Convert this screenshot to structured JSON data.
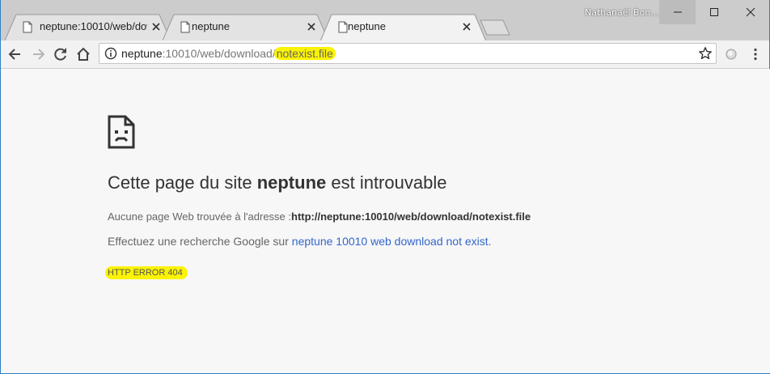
{
  "window": {
    "user_name": "Nathanaël Bon..."
  },
  "tabs": [
    {
      "title": "neptune:10010/web/dow",
      "active": false
    },
    {
      "title": "neptune",
      "active": false
    },
    {
      "title": "neptune",
      "active": true
    }
  ],
  "omnibox": {
    "host": "neptune",
    "path": ":10010/web/download/",
    "highlighted": "notexist.file"
  },
  "error_page": {
    "headline_prefix": "Cette page du site ",
    "headline_host": "neptune",
    "headline_suffix": " est introuvable",
    "detail_prefix": "Aucune page Web trouvée à l'adresse :",
    "detail_url": "http://neptune:10010/web/download/notexist.file",
    "search_prefix": "Effectuez une recherche Google sur ",
    "search_link": "neptune 10010 web download not exist",
    "search_suffix": ".",
    "error_code": "HTTP ERROR 404"
  },
  "colors": {
    "highlight": "#fbf304",
    "link": "#3366cc",
    "window_border": "#2d7fc8"
  },
  "icons": [
    "page-icon",
    "close-icon",
    "back-arrow-icon",
    "forward-arrow-icon",
    "reload-icon",
    "home-icon",
    "info-icon",
    "star-icon",
    "extension-icon",
    "menu-dots-icon",
    "sad-page-icon",
    "minimize-icon",
    "maximize-icon",
    "window-close-icon"
  ]
}
